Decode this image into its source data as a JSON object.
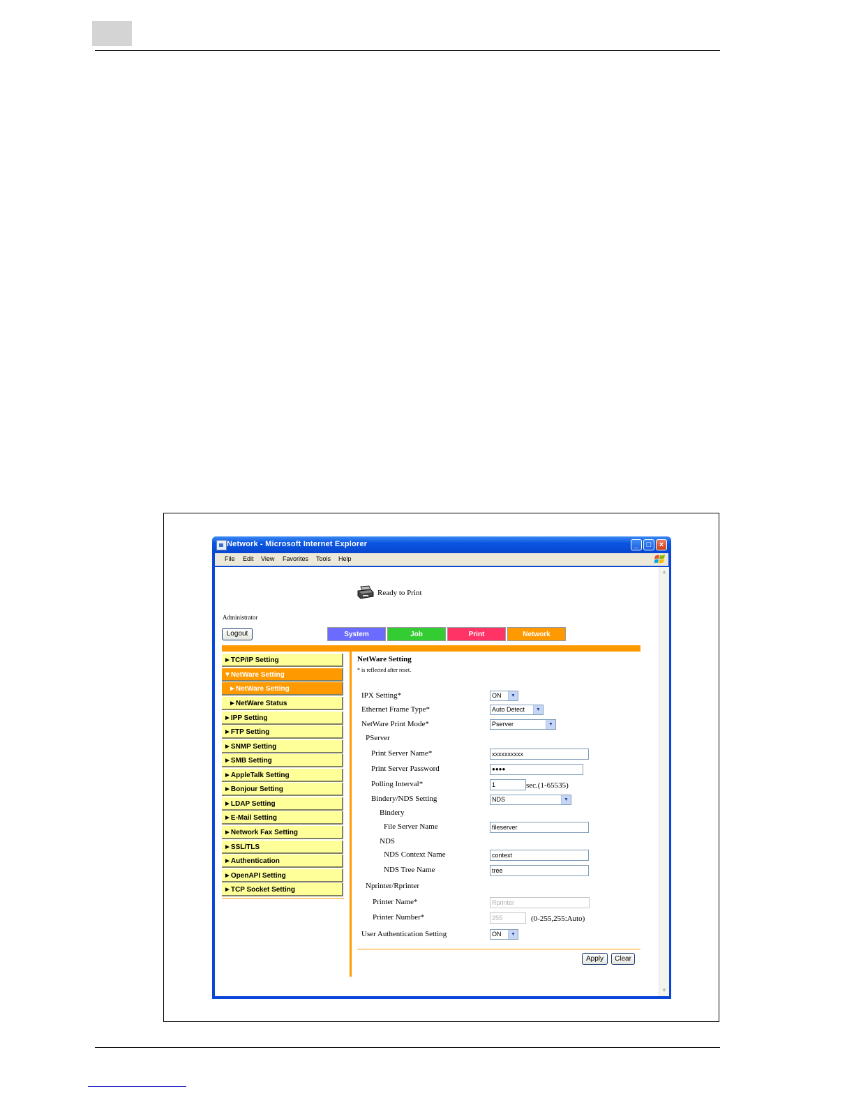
{
  "window": {
    "title": "Network - Microsoft Internet Explorer",
    "menu": [
      "File",
      "Edit",
      "View",
      "Favorites",
      "Tools",
      "Help"
    ]
  },
  "header": {
    "status": "Ready to Print",
    "user": "Administrator",
    "logout_label": "Logout",
    "tabs": [
      {
        "label": "System",
        "color": "#6b6bff"
      },
      {
        "label": "Job",
        "color": "#33cc33"
      },
      {
        "label": "Print",
        "color": "#ff3366"
      },
      {
        "label": "Network",
        "color": "#ff9900"
      }
    ]
  },
  "sidebar": {
    "items": [
      "►TCP/IP Setting",
      "▼NetWare Setting",
      "►NetWare Setting",
      "►NetWare Status",
      "►IPP Setting",
      "►FTP Setting",
      "►SNMP Setting",
      "►SMB Setting",
      "►AppleTalk Setting",
      "►Bonjour Setting",
      "►LDAP Setting",
      "►E-Mail Setting",
      "►Network Fax Setting",
      "►SSL/TLS",
      "►Authentication",
      "►OpenAPI Setting",
      "►TCP Socket Setting"
    ]
  },
  "main": {
    "title": "NetWare Setting",
    "note": "* is reflected after reset.",
    "ipx_label": "IPX Setting*",
    "ipx_value": "ON",
    "frame_label": "Ethernet Frame Type*",
    "frame_value": "Auto Detect",
    "mode_label": "NetWare Print Mode*",
    "mode_value": "Pserver",
    "pserver_label": "PServer",
    "ps_name_label": "Print Server Name*",
    "ps_name_value": "xxxxxxxxxx",
    "ps_pass_label": "Print Server Password",
    "ps_pass_value": "●●●●",
    "polling_label": "Polling Interval*",
    "polling_value": "1",
    "polling_hint": "sec.(1-65535)",
    "bindery_nds_label": "Bindery/NDS Setting",
    "bindery_nds_value": "NDS",
    "bindery_label": "Bindery",
    "file_server_label": "File Server Name",
    "file_server_value": "fileserver",
    "nds_label": "NDS",
    "nds_context_label": "NDS Context Name",
    "nds_context_value": "context",
    "nds_tree_label": "NDS Tree Name",
    "nds_tree_value": "tree",
    "nprinter_label": "Nprinter/Rprinter",
    "printer_name_label": "Printer Name*",
    "printer_name_value": "Rprinter",
    "printer_number_label": "Printer Number*",
    "printer_number_value": "255",
    "printer_number_hint": "(0-255,255:Auto)",
    "user_auth_label": "User Authentication Setting",
    "user_auth_value": "ON",
    "apply_label": "Apply",
    "clear_label": "Clear"
  }
}
